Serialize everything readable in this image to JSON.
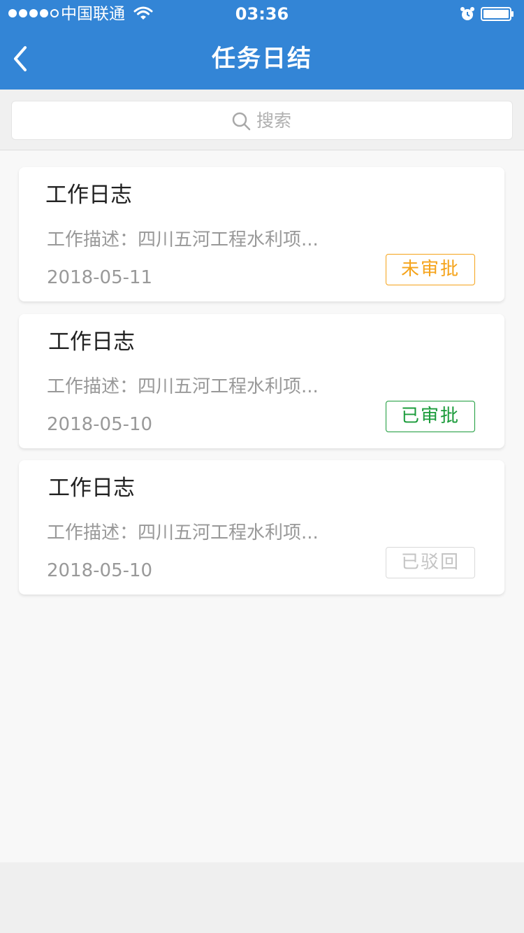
{
  "status_bar": {
    "carrier": "中国联通",
    "time": "03:36"
  },
  "nav": {
    "title": "任务日结"
  },
  "search": {
    "placeholder": "搜索"
  },
  "cards": [
    {
      "title": "工作日志",
      "desc": "工作描述：四川五河工程水利项...",
      "date": "2018-05-11",
      "status": "未审批",
      "status_color": "#f5a31a"
    },
    {
      "title": "工作日志",
      "desc": "工作描述：四川五河工程水利项...",
      "date": "2018-05-10",
      "status": "已审批",
      "status_color": "#1a9b3a"
    },
    {
      "title": "工作日志",
      "desc": "工作描述：四川五河工程水利项...",
      "date": "2018-05-10",
      "status": "已驳回",
      "status_color": "#c4c4c4"
    }
  ],
  "colors": {
    "header": "#3385d6",
    "page_background": "#f8f8f8"
  },
  "icons": [
    "signal-dots-icon",
    "wifi-icon",
    "alarm-icon",
    "battery-icon",
    "back-icon",
    "search-icon"
  ]
}
